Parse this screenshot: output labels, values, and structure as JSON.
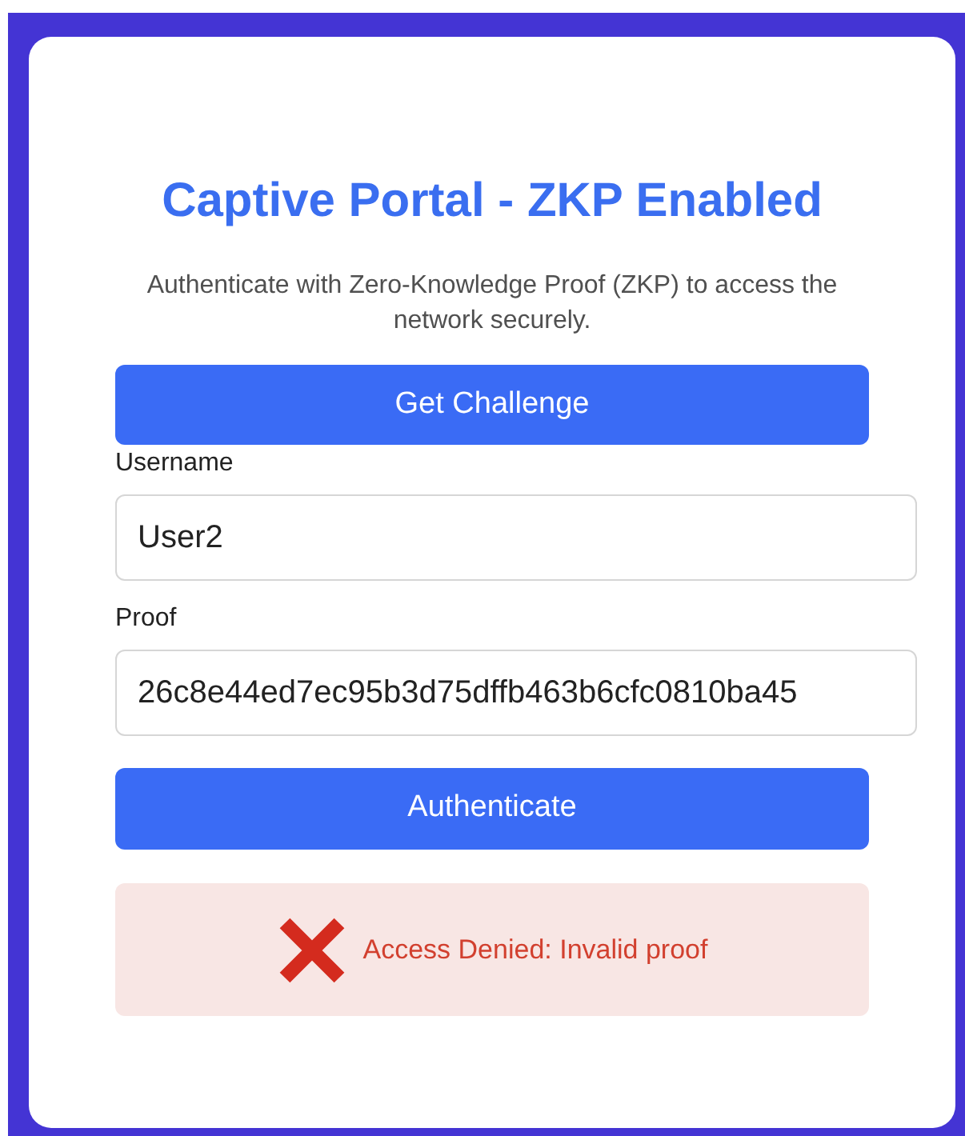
{
  "title": "Captive Portal - ZKP Enabled",
  "description": "Authenticate with Zero-Knowledge Proof (ZKP) to access the network securely.",
  "challenge_button": "Get Challenge",
  "fields": [
    {
      "label": "Username",
      "value": "User2"
    },
    {
      "label": "Proof",
      "value": "26c8e44ed7ec95b3d75dffb463b6cfc0810ba45"
    }
  ],
  "authenticate_button": "Authenticate",
  "status": {
    "kind": "error",
    "message": "Access Denied: Invalid proof"
  }
}
